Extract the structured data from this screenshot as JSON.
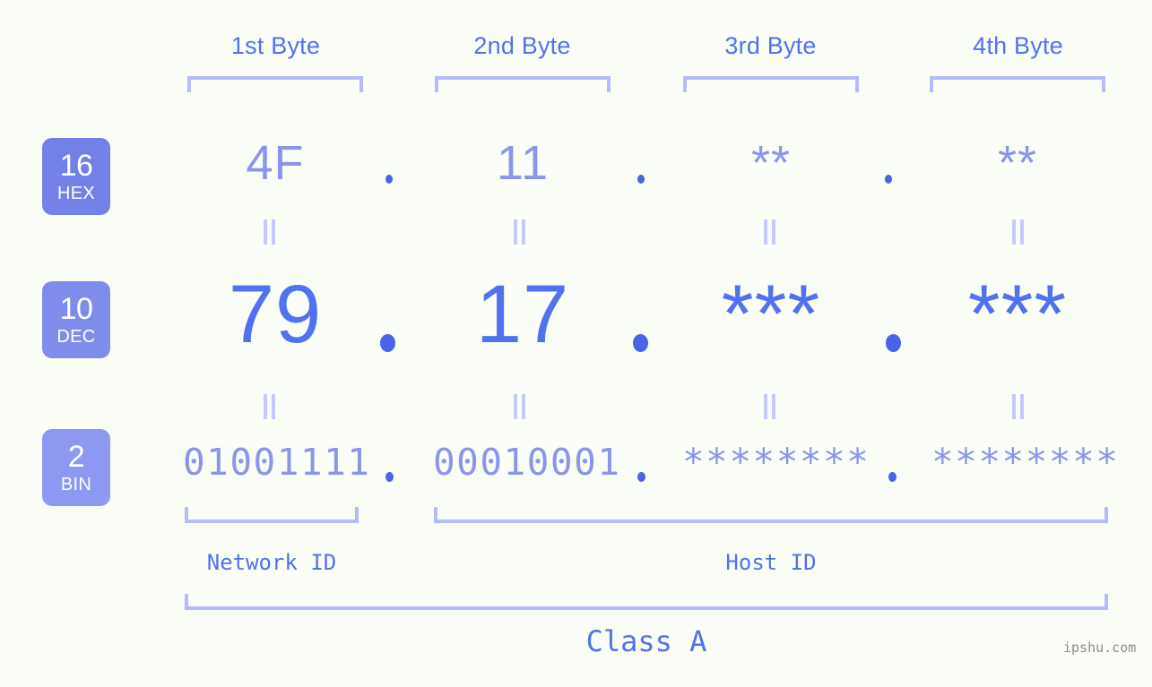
{
  "meta": {
    "background": "#fbfdf7",
    "accent_strong": "#5271ee",
    "accent_light": "#8b96ea",
    "bracket": "#b4bcf9",
    "badge_hex": "#7380e8",
    "badge_dec": "#7f8cec",
    "badge_bin": "#8d99f0",
    "watermark_color": "#8d8d8d"
  },
  "headers": {
    "byte1": "1st Byte",
    "byte2": "2nd Byte",
    "byte3": "3rd Byte",
    "byte4": "4th Byte"
  },
  "bases": [
    {
      "num": "16",
      "name": "HEX"
    },
    {
      "num": "10",
      "name": "DEC"
    },
    {
      "num": "2",
      "name": "BIN"
    }
  ],
  "rows": {
    "hex": {
      "b1": "4F",
      "b2": "11",
      "b3": "**",
      "b4": "**"
    },
    "dec": {
      "b1": "79",
      "b2": "17",
      "b3": "***",
      "b4": "***"
    },
    "bin": {
      "b1": "01001111",
      "b2": "00010001",
      "b3": "********",
      "b4": "********"
    }
  },
  "separator": ".",
  "footer": {
    "network_id": "Network ID",
    "host_id": "Host ID",
    "class": "Class A"
  },
  "watermark": "ipshu.com"
}
